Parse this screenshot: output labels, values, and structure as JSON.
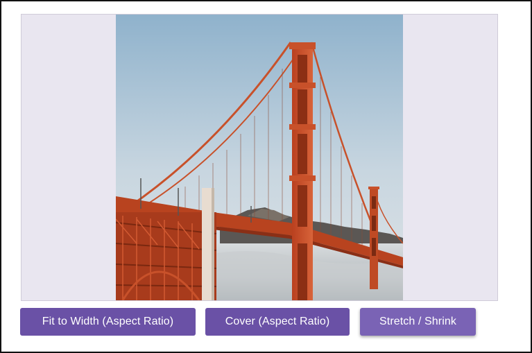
{
  "viewer": {
    "image_subject": "golden-gate-bridge-photo"
  },
  "buttons": [
    {
      "label": "Fit to Width (Aspect Ratio)",
      "selected": false
    },
    {
      "label": "Cover (Aspect Ratio)",
      "selected": false
    },
    {
      "label": "Stretch / Shrink",
      "selected": true
    }
  ],
  "colors": {
    "button_bg": "#6a51a6",
    "button_active_bg": "#7a63b5",
    "viewer_bg": "#e9e6f0",
    "button_text": "#ffffff"
  }
}
